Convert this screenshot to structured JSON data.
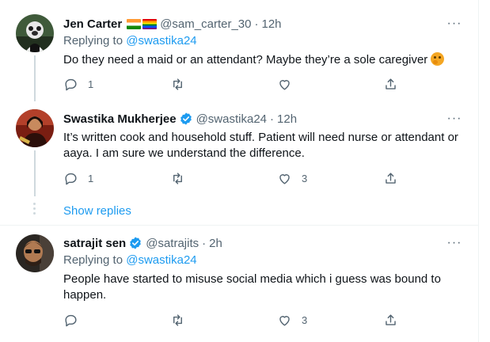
{
  "tweets": [
    {
      "name": "Jen Carter",
      "handle": "@sam_carter_30",
      "separator": "·",
      "time": "12h",
      "reply_prefix": "Replying to ",
      "reply_to": "@swastika24",
      "text": "Do they need a maid or an attendant? Maybe they’re a sole caregiver",
      "emoji": "thinking-face-emoji",
      "reply_count": "1",
      "like_count": "",
      "flags": [
        "india-flag",
        "rainbow-flag"
      ]
    },
    {
      "name": "Swastika Mukherjee",
      "handle": "@swastika24",
      "separator": "·",
      "time": "12h",
      "text": "It’s written cook and household stuff. Patient will need nurse or attendant or aaya. I am sure we understand the difference.",
      "reply_count": "1",
      "like_count": "3",
      "verified": true
    },
    {
      "name": "satrajit sen",
      "handle": "@satrajits",
      "separator": "·",
      "time": "2h",
      "reply_prefix": "Replying to ",
      "reply_to": "@swastika24",
      "text": "People have started to misuse social media which i guess was bound to happen.",
      "reply_count": "",
      "like_count": "3",
      "verified": true
    }
  ],
  "show_replies": "Show replies",
  "more_label": "···",
  "colors": {
    "accent": "#1d9bf0",
    "muted": "#536471",
    "text": "#0f1419",
    "border": "#eff3f4"
  },
  "icons": [
    "reply-icon",
    "retweet-icon",
    "like-icon",
    "share-icon",
    "verified-badge-icon",
    "more-icon"
  ]
}
